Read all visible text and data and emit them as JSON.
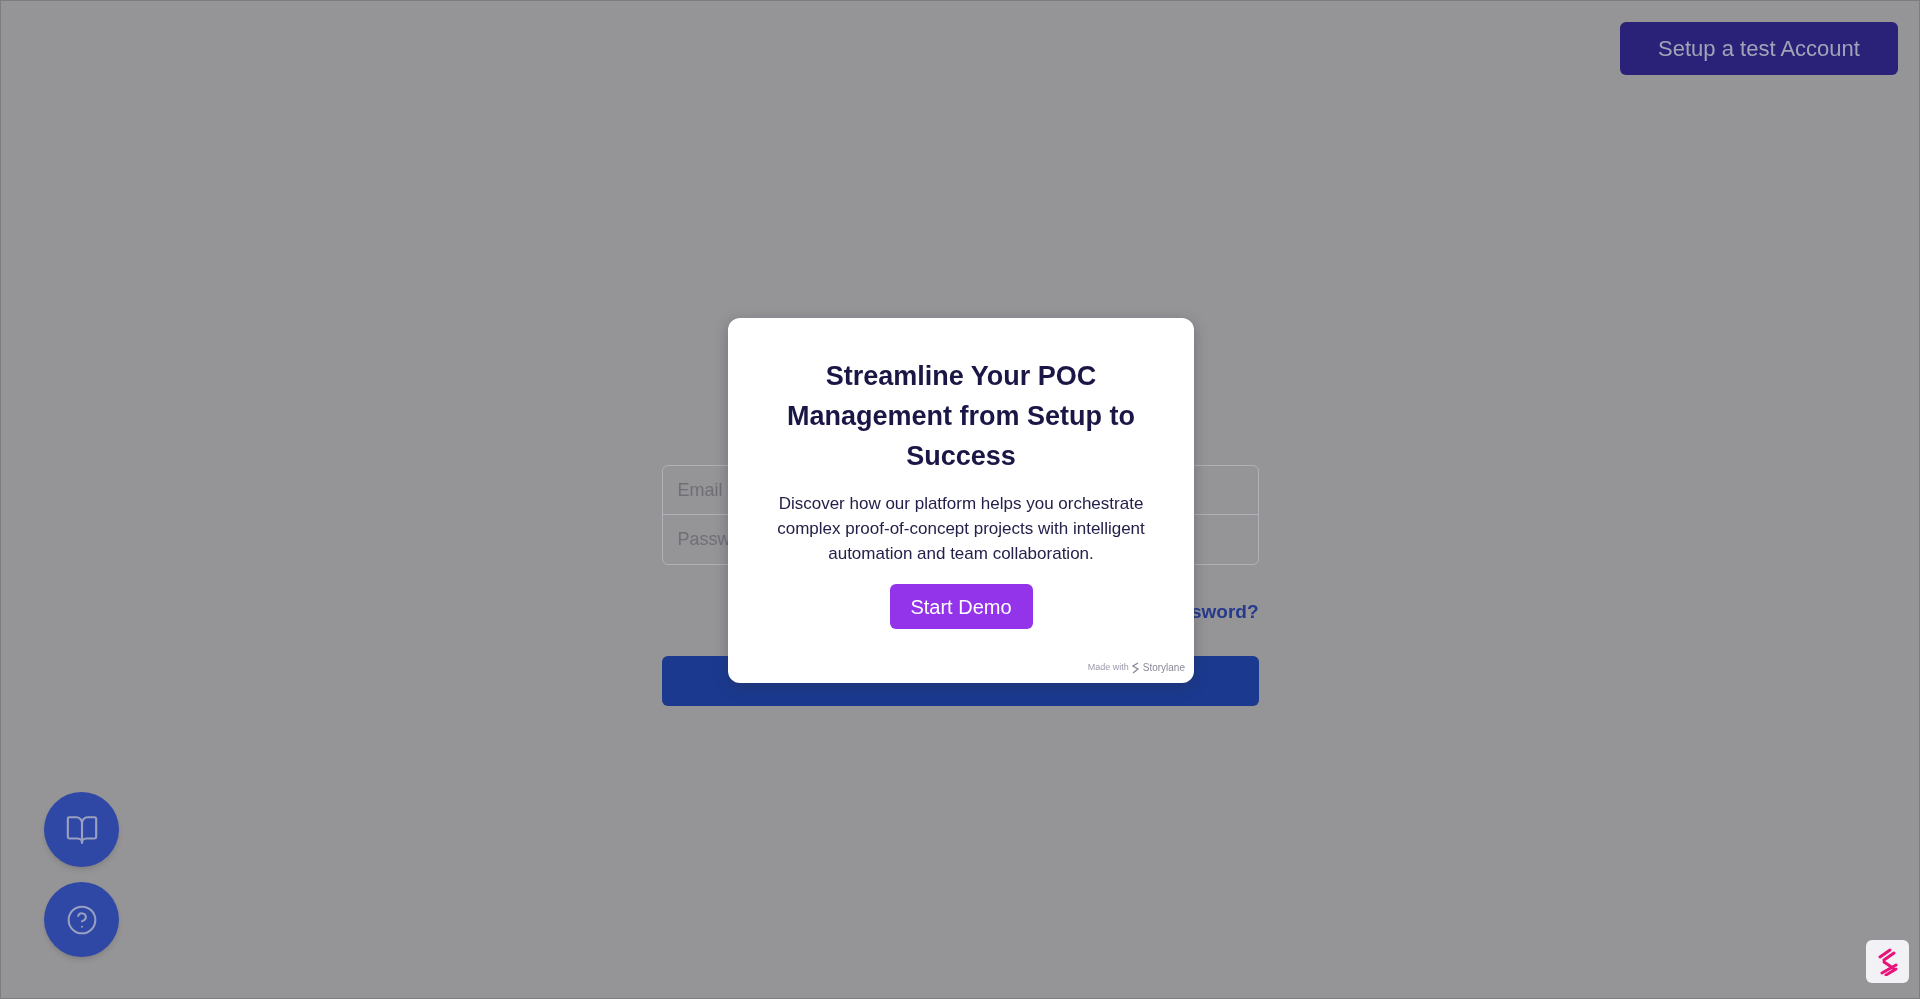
{
  "header": {
    "button": "Setup a test Account"
  },
  "login_form": {
    "email_placeholder": "Email",
    "password_placeholder": "Passw",
    "forgot_link": "sword?"
  },
  "modal": {
    "title": "Streamline Your POC Management from Setup to Success",
    "description": "Discover how our platform helps you orchestrate complex proof-of-concept projects with intelligent automation and team collaboration.",
    "button": "Start Demo",
    "credit_prefix": "Made with",
    "credit_brand": "Storylane"
  }
}
